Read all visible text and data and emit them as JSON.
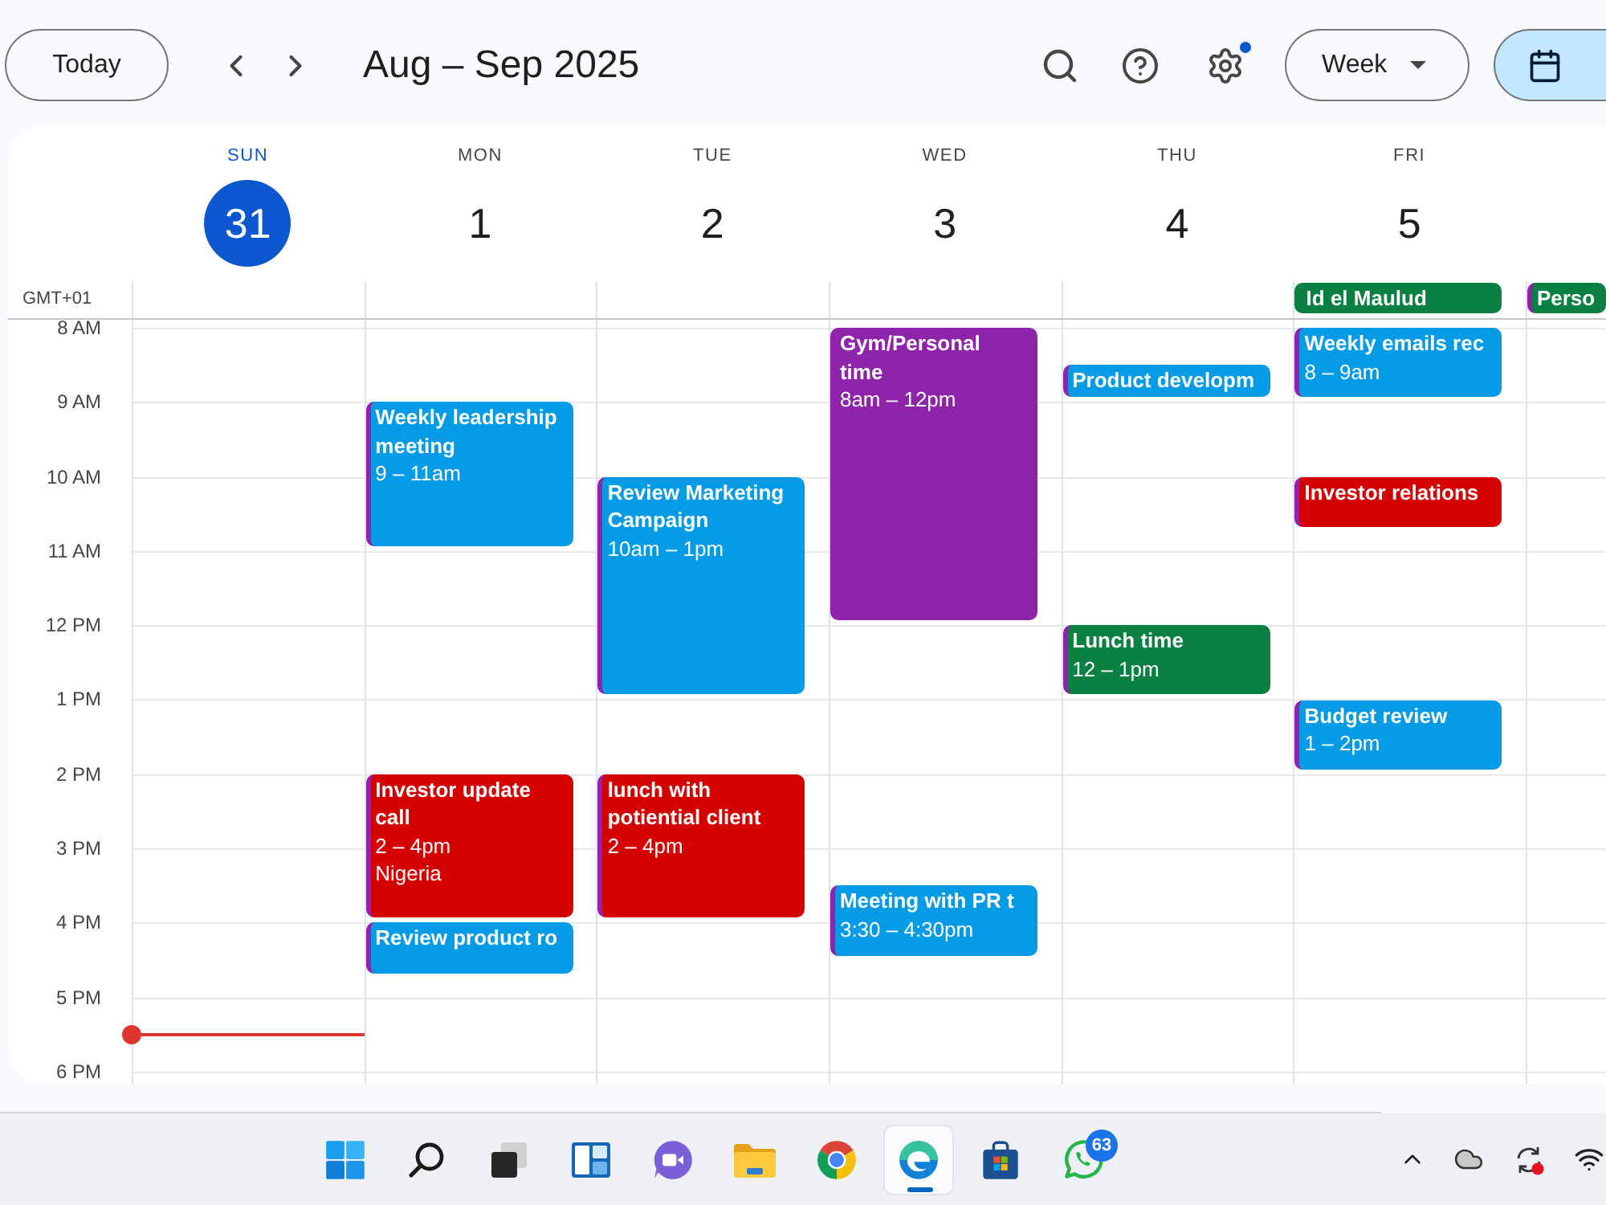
{
  "toolbar": {
    "today_button": "Today",
    "title": "Aug – Sep 2025",
    "settings_notification": true,
    "view_menu": "Week",
    "view_switch": [
      {
        "kind": "calendar",
        "selected": true
      }
    ]
  },
  "timezone": "GMT+01",
  "hours": [
    "8 AM",
    "9 AM",
    "10 AM",
    "11 AM",
    "12 PM",
    "1 PM",
    "2 PM",
    "3 PM",
    "4 PM",
    "5 PM",
    "6 PM"
  ],
  "days": [
    {
      "label": "SUN",
      "date": "31",
      "selected": true
    },
    {
      "label": "MON",
      "date": "1",
      "selected": false,
      "events": [
        {
          "title": "Weekly leadership meeting",
          "time": "9 – 11am",
          "color": "#039be5",
          "accent_stripe": true
        },
        {
          "title": "Investor update call",
          "time": "2 – 4pm",
          "location": "Nigeria",
          "color": "#d50000",
          "accent_stripe": true
        },
        {
          "title": "Review product ro",
          "color": "#039be5",
          "accent_stripe": true
        }
      ]
    },
    {
      "label": "TUE",
      "date": "2",
      "selected": false,
      "events": [
        {
          "title": "Review Marketing Campaign",
          "time": "10am – 1pm",
          "color": "#039be5",
          "accent_stripe": true
        },
        {
          "title": "lunch with potiential client",
          "time": "2 – 4pm",
          "color": "#d50000",
          "accent_stripe": true
        }
      ]
    },
    {
      "label": "WED",
      "date": "3",
      "selected": false,
      "events": [
        {
          "title": "Gym/Personal time",
          "time": "8am – 12pm",
          "color": "#8e24aa",
          "accent_stripe": false
        },
        {
          "title": "Meeting with PR t",
          "time": "3:30 – 4:30pm",
          "color": "#039be5",
          "accent_stripe": true
        }
      ]
    },
    {
      "label": "THU",
      "date": "4",
      "selected": false,
      "events": [
        {
          "title": "Product developm",
          "color": "#039be5",
          "accent_stripe": true
        },
        {
          "title": "Lunch time",
          "time": "12 – 1pm",
          "color": "#0b8043",
          "accent_stripe": true
        }
      ]
    },
    {
      "label": "FRI",
      "date": "5",
      "selected": false,
      "all_day": [
        {
          "title": "Id el Maulud",
          "color": "#0b8043",
          "accent_stripe": false
        }
      ],
      "events": [
        {
          "title": "Weekly emails rec",
          "time": "8 – 9am",
          "color": "#039be5",
          "accent_stripe": true
        },
        {
          "title": "Investor relations",
          "color": "#d50000",
          "accent_stripe": true
        },
        {
          "title": "Budget review",
          "time": "1 – 2pm",
          "color": "#039be5",
          "accent_stripe": true
        }
      ]
    },
    {
      "all_day": [
        {
          "title": "Perso",
          "color": "#0b8043",
          "accent_stripe": true
        }
      ]
    }
  ],
  "taskbar": {
    "apps": [
      {
        "kind": "start",
        "selected": false
      },
      {
        "kind": "search",
        "selected": false
      },
      {
        "kind": "taskview",
        "selected": false
      },
      {
        "kind": "widgets",
        "selected": false
      },
      {
        "kind": "meet",
        "selected": false
      },
      {
        "kind": "folder",
        "selected": false
      },
      {
        "kind": "chrome",
        "selected": false
      },
      {
        "kind": "edge",
        "selected": true
      },
      {
        "kind": "store",
        "selected": false
      },
      {
        "kind": "whatsapp",
        "selected": false,
        "badge": "63"
      }
    ]
  }
}
